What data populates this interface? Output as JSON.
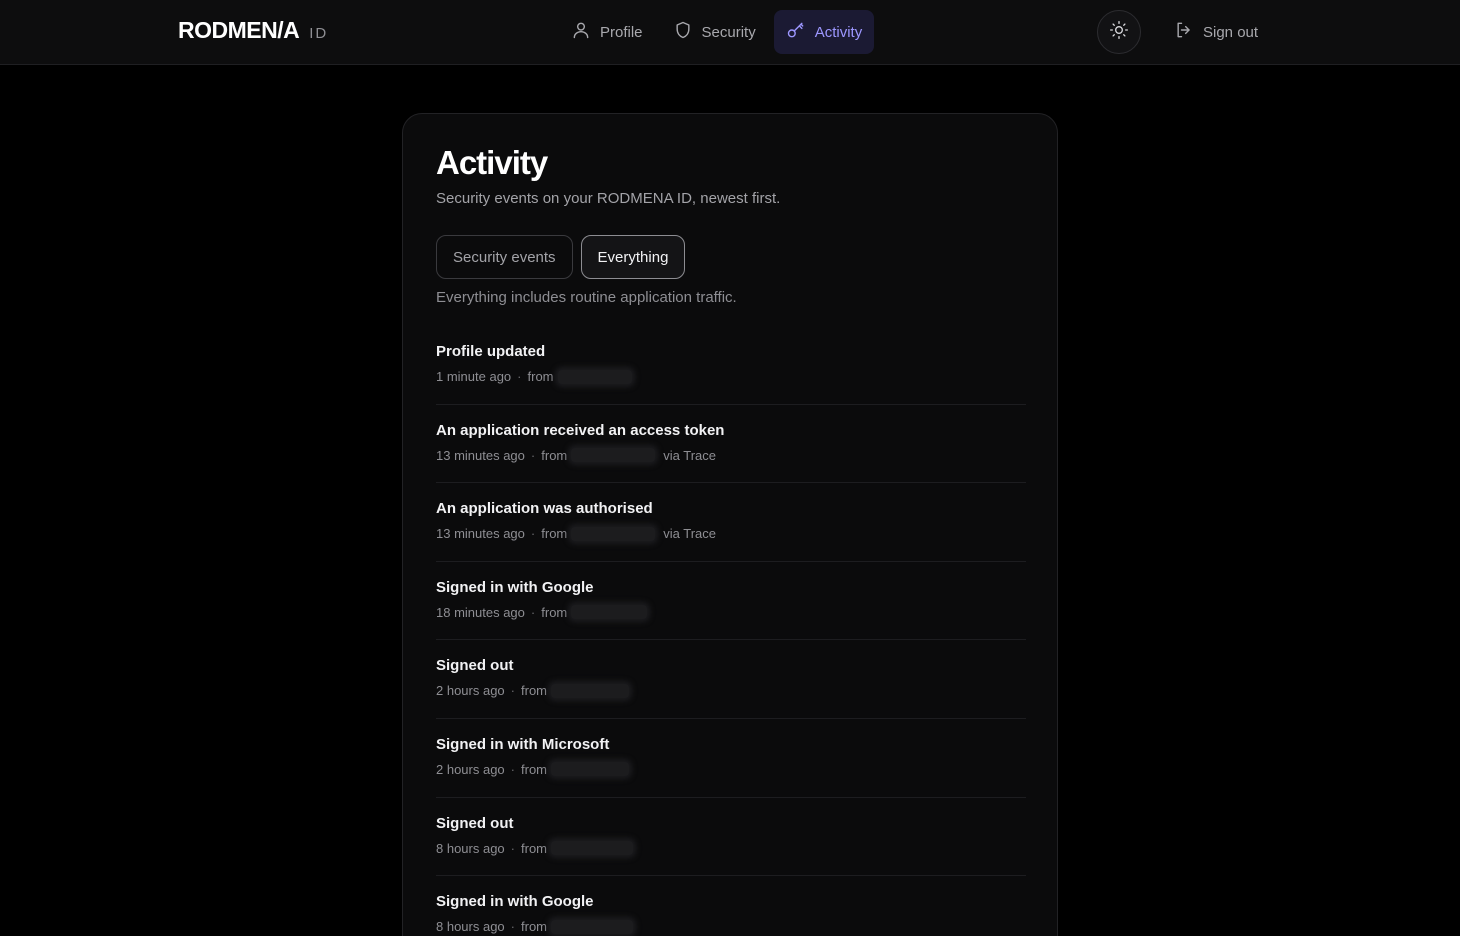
{
  "header": {
    "logo_text": "RODMEN/A",
    "logo_suffix": "ID",
    "nav": [
      {
        "label": "Profile",
        "icon": "user-icon",
        "active": false
      },
      {
        "label": "Security",
        "icon": "shield-icon",
        "active": false
      },
      {
        "label": "Activity",
        "icon": "key-icon",
        "active": true
      }
    ],
    "theme_toggle_icon": "sun-icon",
    "sign_out_label": "Sign out",
    "accent_color": "#9d97ff"
  },
  "page": {
    "title": "Activity",
    "subtitle": "Security events on your RODMENA ID, newest first.",
    "filters": [
      {
        "label": "Security events",
        "selected": false
      },
      {
        "label": "Everything",
        "selected": true
      }
    ],
    "filter_note": "Everything includes routine application traffic."
  },
  "events": [
    {
      "title": "Profile updated",
      "time": "1 minute ago",
      "from": "from",
      "via": ""
    },
    {
      "title": "An application received an access token",
      "time": "13 minutes ago",
      "from": "from",
      "via": "via Trace"
    },
    {
      "title": "An application was authorised",
      "time": "13 minutes ago",
      "from": "from",
      "via": "via Trace"
    },
    {
      "title": "Signed in with Google",
      "time": "18 minutes ago",
      "from": "from",
      "via": ""
    },
    {
      "title": "Signed out",
      "time": "2 hours ago",
      "from": "from",
      "via": ""
    },
    {
      "title": "Signed in with Microsoft",
      "time": "2 hours ago",
      "from": "from",
      "via": ""
    },
    {
      "title": "Signed out",
      "time": "8 hours ago",
      "from": "from",
      "via": ""
    },
    {
      "title": "Signed in with Google",
      "time": "8 hours ago",
      "from": "from",
      "via": ""
    }
  ]
}
